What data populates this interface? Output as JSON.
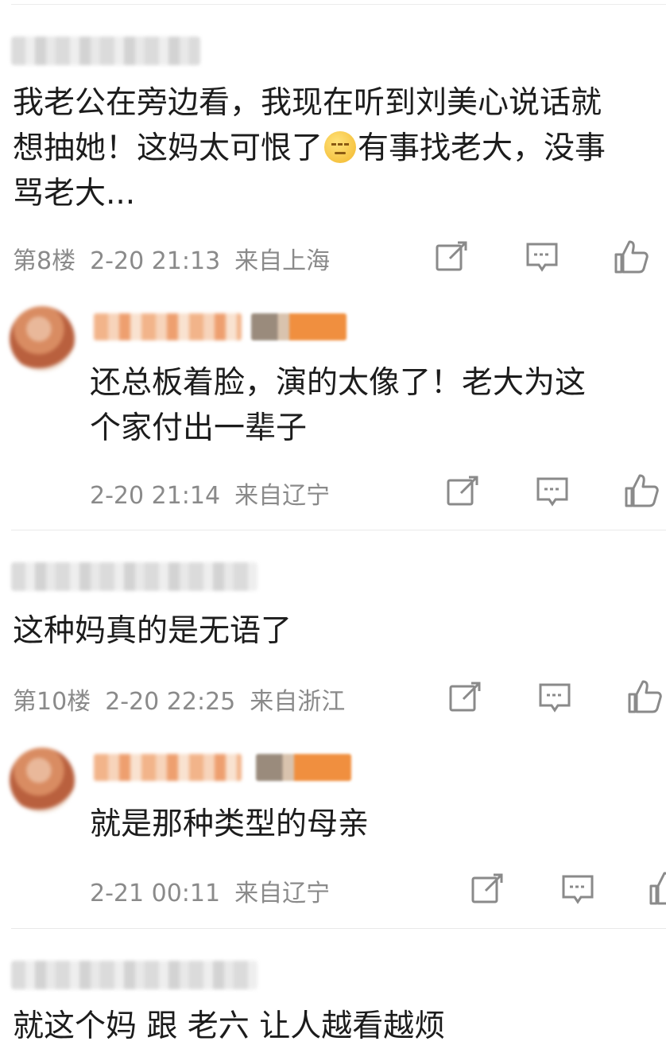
{
  "comments": [
    {
      "text_line1": "我老公在旁边看，我现在听到刘美心说话就",
      "text_line2_a": "想抽她！这妈太可恨了",
      "emoji": "smiling-face-emoji",
      "text_line2_b": "有事找老大，没事",
      "text_line3": "骂老大...",
      "floor": "第8楼",
      "time": "2-20 21:13",
      "location": "来自上海",
      "reply": {
        "text_line1": "还总板着脸，演的太像了！老大为这",
        "text_line2": "个家付出一辈子",
        "time": "2-20 21:14",
        "location": "来自辽宁"
      }
    },
    {
      "text_line1": "这种妈真的是无语了",
      "floor": "第10楼",
      "time": "2-20 22:25",
      "location": "来自浙江",
      "reply": {
        "text_line1": "就是那种类型的母亲",
        "time": "2-21 00:11",
        "location": "来自辽宁"
      }
    },
    {
      "text_line1": "就这个妈 跟 老六 让人越看越烦"
    }
  ],
  "icons": {
    "share": "share-edit-icon",
    "comment": "comment-bubble-icon",
    "like": "thumbs-up-icon"
  },
  "colors": {
    "meta_text": "#8a8a8a",
    "body_text": "#1c1c1c",
    "separator": "#e9e9e9"
  }
}
